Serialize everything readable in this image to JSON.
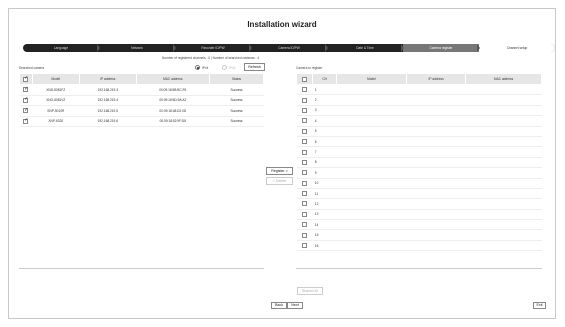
{
  "wizard": {
    "title": "Installation wizard"
  },
  "steps": [
    {
      "label": "Language",
      "state": "done"
    },
    {
      "label": "Network",
      "state": "done"
    },
    {
      "label": "Recorder ID/PW",
      "state": "done"
    },
    {
      "label": "Camera ID/PW",
      "state": "done"
    },
    {
      "label": "Date & Time",
      "state": "done"
    },
    {
      "label": "Camera register",
      "state": "active"
    },
    {
      "label": "Channel setup",
      "state": "next"
    }
  ],
  "counts": {
    "text": "Number of registered channels : 0 | Number of searched cameras : 4"
  },
  "ip_mode": {
    "ipv4": "IPv4",
    "ipv6": "IPv6",
    "selected": "IPv4"
  },
  "buttons": {
    "refresh": "Refresh",
    "register": "Register >",
    "delete": "< Delete",
    "shared_id": "Shared ID",
    "back": "Back",
    "next": "Next",
    "exit": "Exit"
  },
  "searched": {
    "label": "Searched camera",
    "columns": [
      "",
      "Model",
      "IP address",
      "MAC address",
      "Status"
    ],
    "rows": [
      {
        "checked": true,
        "model": "XND-8081FZ",
        "ip": "192.168.219.3",
        "mac": "00:09:18:5B:BC:F6",
        "status": "Success"
      },
      {
        "checked": true,
        "model": "XNO-8081VZ",
        "ip": "192.168.219.4",
        "mac": "00:09:18:5D:9A:A2",
        "status": "Success"
      },
      {
        "checked": true,
        "model": "SNP-9010R",
        "ip": "192.168.219.5",
        "mac": "00:09:18:48:D2:0D",
        "status": "Success"
      },
      {
        "checked": true,
        "model": "XNP-6320",
        "ip": "192.168.219.6",
        "mac": "00:09:18:52:9F:D8",
        "status": "Success"
      }
    ]
  },
  "toreg": {
    "label": "Camera to register",
    "columns": [
      "",
      "CH",
      "Model",
      "IP address",
      "MAC address"
    ],
    "channels": [
      "1",
      "2",
      "3",
      "4",
      "5",
      "6",
      "7",
      "8",
      "9",
      "10",
      "11",
      "12",
      "13",
      "14",
      "15",
      "16"
    ]
  }
}
